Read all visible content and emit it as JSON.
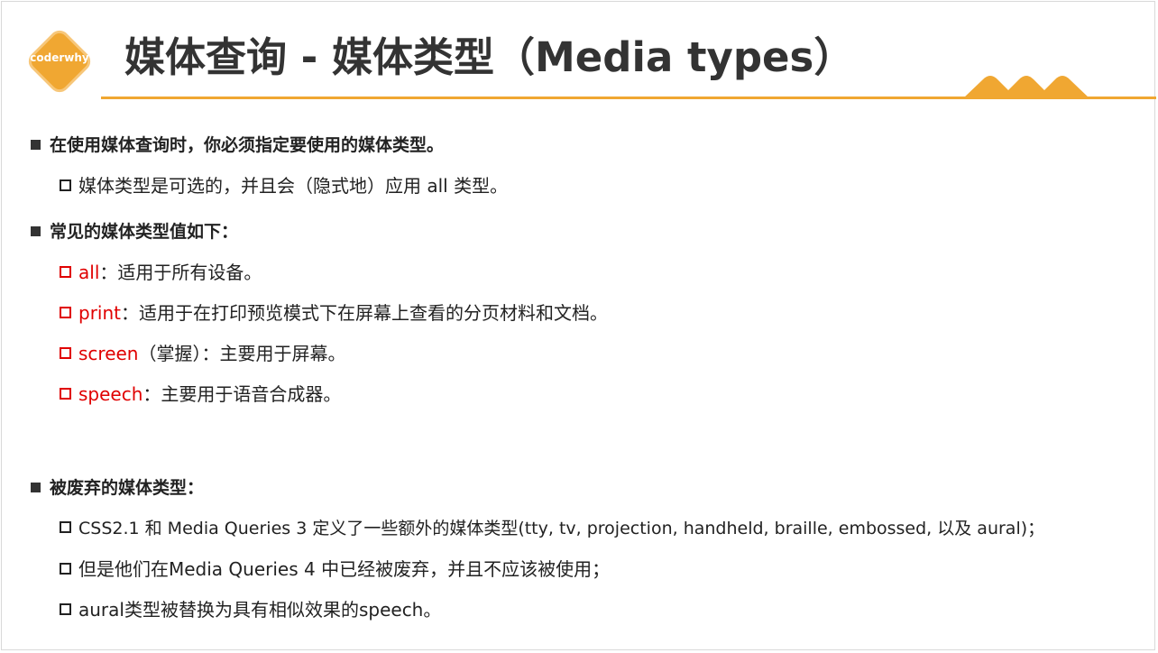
{
  "logo": {
    "text": "coderwhy"
  },
  "title": "媒体查询 - 媒体类型（Media types）",
  "colors": {
    "accent": "#f0a732",
    "keyword": "#e00000",
    "text": "#222222"
  },
  "sections": [
    {
      "heading": "在使用媒体查询时，你必须指定要使用的媒体类型。",
      "items": [
        {
          "text": "媒体类型是可选的，并且会（隐式地）应用 all 类型。"
        }
      ]
    },
    {
      "heading": "常见的媒体类型值如下：",
      "items": [
        {
          "keyword": "all",
          "text": "：适用于所有设备。"
        },
        {
          "keyword": "print",
          "text": "：适用于在打印预览模式下在屏幕上查看的分页材料和文档。"
        },
        {
          "keyword": "screen",
          "text": "（掌握）：主要用于屏幕。"
        },
        {
          "keyword": "speech",
          "text": "：主要用于语音合成器。"
        }
      ]
    },
    {
      "heading": "被废弃的媒体类型：",
      "items": [
        {
          "text": "CSS2.1 和  Media Queries 3 定义了一些额外的媒体类型(tty, tv, projection, handheld, braille, embossed, 以及 aural)；"
        },
        {
          "text": "但是他们在Media Queries 4 中已经被废弃，并且不应该被使用；"
        },
        {
          "text": "aural类型被替换为具有相似效果的speech。"
        }
      ]
    }
  ]
}
